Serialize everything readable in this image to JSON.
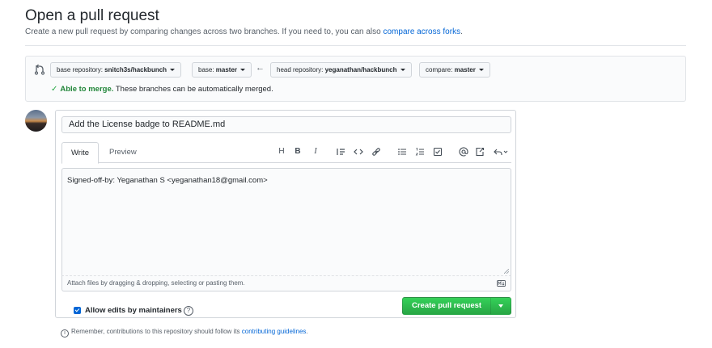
{
  "header": {
    "title": "Open a pull request",
    "subtitle": "Create a new pull request by comparing changes across two branches. If you need to, you can also",
    "subtitle_link": "compare across forks",
    "subtitle_end": "."
  },
  "range": {
    "icon": "git-compare-icon",
    "base_repo_prefix": "base repository: ",
    "base_repo_value": "snitch3s/hackbunch",
    "base_branch_prefix": "base: ",
    "base_branch_value": "master",
    "arrow": "←",
    "head_repo_prefix": "head repository: ",
    "head_repo_value": "yeganathan/hackbunch",
    "compare_prefix": "compare: ",
    "compare_value": "master",
    "merge_check": "✓",
    "merge_ok": "Able to merge.",
    "merge_text": "These branches can be automatically merged."
  },
  "form": {
    "title_value": "Add the License badge to README.md",
    "tabs": [
      "Write",
      "Preview"
    ],
    "toolbar": {
      "heading": "H",
      "bold": "B",
      "italic": "I"
    },
    "body_value": "Signed-off-by: Yeganathan S <yeganathan18@gmail.com>",
    "attach_hint": "Attach files by dragging & dropping, selecting or pasting them.",
    "allow_edits_label": "Allow edits by maintainers",
    "allow_edits_checked": true,
    "help": "?",
    "submit_label": "Create pull request"
  },
  "footer": {
    "info": "i",
    "text": "Remember, contributions to this repository should follow its",
    "link": "contributing guidelines",
    "end": "."
  },
  "colors": {
    "link": "#0366d6",
    "success": "#28a745",
    "primary_button": "#2ea44f"
  }
}
